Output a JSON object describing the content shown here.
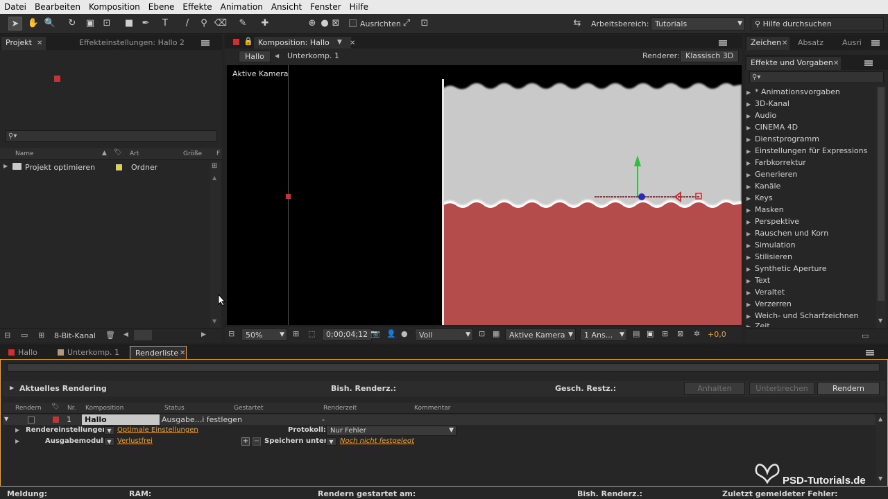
{
  "menu": [
    "Datei",
    "Bearbeiten",
    "Komposition",
    "Ebene",
    "Effekte",
    "Animation",
    "Ansicht",
    "Fenster",
    "Hilfe"
  ],
  "toolbar": {
    "align_label": "Ausrichten",
    "workspace_label": "Arbeitsbereich:",
    "workspace_value": "Tutorials",
    "help_placeholder": "Hilfe durchsuchen"
  },
  "project_panel": {
    "tab_project": "Projekt",
    "tab_effect_settings": "Effekteinstellungen: Hallo 2",
    "columns": {
      "name": "Name",
      "type": "Art",
      "size": "Größe",
      "f": "F"
    },
    "items": [
      {
        "name": "Projekt optimieren",
        "type": "Ordner",
        "label_color": "#e2cf4a"
      }
    ],
    "bit_depth": "8-Bit-Kanal"
  },
  "comp_panel": {
    "tab_label": "Komposition: Hallo",
    "breadcrumb": [
      "Hallo",
      "Unterkomp. 1"
    ],
    "renderer_label": "Renderer:",
    "renderer_value": "Klassisch 3D",
    "viewer_label": "Aktive Kamera",
    "zoom": "50%",
    "timecode": "0;00;04;12",
    "resolution": "Voll",
    "camera": "Aktive Kamera",
    "views": "1 Ans...",
    "exposure": "+0,0"
  },
  "right_panel": {
    "tabs": [
      "Zeichen",
      "Absatz",
      "Ausri"
    ],
    "effects_tab": "Effekte und Vorgaben",
    "items": [
      "* Animationsvorgaben",
      "3D-Kanal",
      "Audio",
      "CINEMA 4D",
      "Dienstprogramm",
      "Einstellungen für Expressions",
      "Farbkorrektur",
      "Generieren",
      "Kanäle",
      "Keys",
      "Masken",
      "Perspektive",
      "Rauschen und Korn",
      "Simulation",
      "Stilisieren",
      "Synthetic Aperture",
      "Text",
      "Veraltet",
      "Verzerren",
      "Weich- und Scharfzeichnen",
      "Zeit"
    ]
  },
  "timeline_tabs": [
    {
      "label": "Hallo",
      "color": "#c0343a"
    },
    {
      "label": "Unterkomp. 1",
      "color": "#b09a7a"
    },
    {
      "label": "Renderliste",
      "color": ""
    }
  ],
  "render_queue": {
    "current_rendering": "Aktuelles Rendering",
    "elapsed": "Bish. Renderz.:",
    "remaining": "Gesch. Restz.:",
    "btn_stop": "Anhalten",
    "btn_pause": "Unterbrechen",
    "btn_render": "Rendern",
    "columns": [
      "Rendern",
      "Nr.",
      "Komposition",
      "Status",
      "Gestartet",
      "Renderzeit",
      "Kommentar"
    ],
    "row": {
      "num": "1",
      "comp": "Hallo",
      "status": "Ausgabe...i festlegen",
      "started": "-",
      "time": "-"
    },
    "render_settings_label": "Rendereinstellungen:",
    "render_settings_value": "Optimale Einstellungen",
    "log_label": "Protokoll:",
    "log_value": "Nur Fehler",
    "output_module_label": "Ausgabemodul:",
    "output_module_value": "Verlustfrei",
    "save_to_label": "Speichern unter:",
    "save_to_value": "Noch nicht festgelegt"
  },
  "status_bar": {
    "message": "Meldung:",
    "ram": "RAM:",
    "started_at": "Rendern gestartet am:",
    "elapsed": "Bish. Renderz.:",
    "last_error": "Zuletzt gemeldeter Fehler:"
  },
  "watermark": "PSD-Tutorials.de"
}
